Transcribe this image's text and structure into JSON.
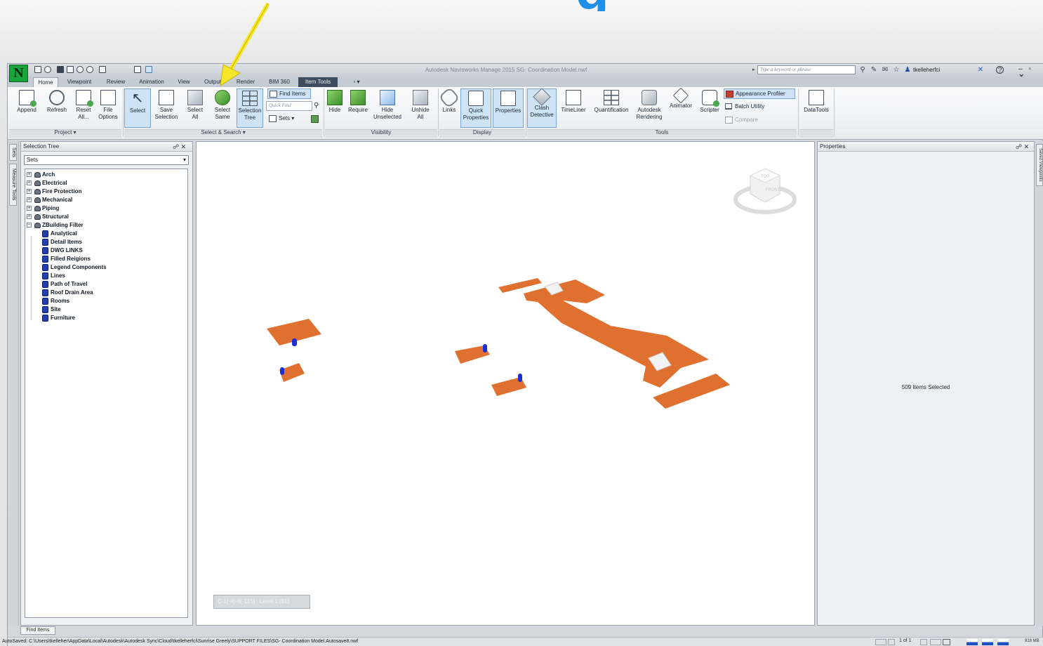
{
  "window": {
    "title": "Autodesk Navisworks Manage 2015   SG- Coordination Model.nwf",
    "logo_letter": "N",
    "help_search_placeholder": "Type a keyword or phrase",
    "user": "tkelleherfci",
    "controls": "– ▫ ✕"
  },
  "slide": {
    "title_fragment": "g"
  },
  "tabs": [
    {
      "label": "Home",
      "active": true
    },
    {
      "label": "Viewpoint"
    },
    {
      "label": "Review"
    },
    {
      "label": "Animation"
    },
    {
      "label": "View"
    },
    {
      "label": "Output"
    },
    {
      "label": "Render"
    },
    {
      "label": "BIM 360"
    },
    {
      "label": "Item Tools",
      "contextual": true
    },
    {
      "label": "▫ ▾"
    }
  ],
  "ribbon": {
    "project": {
      "title": "Project ▾",
      "buttons": [
        {
          "label": "Append",
          "icon": "append-icon"
        },
        {
          "label": "Refresh",
          "icon": "refresh-icon"
        },
        {
          "label": "Reset\nAll...",
          "icon": "reset-all-icon"
        },
        {
          "label": "File\nOptions",
          "icon": "file-options-icon"
        }
      ]
    },
    "select_search": {
      "title": "Select & Search ▾",
      "buttons": [
        {
          "label": "Select",
          "icon": "select-cursor-icon"
        },
        {
          "label": "Save\nSelection",
          "icon": "save-selection-icon"
        },
        {
          "label": "Select\nAll",
          "icon": "select-all-icon"
        },
        {
          "label": "Select\nSame",
          "icon": "select-same-icon"
        },
        {
          "label": "Selection\nTree",
          "icon": "selection-tree-icon"
        }
      ],
      "find_items": "Find Items",
      "quick_find_placeholder": "Quick Find",
      "sets": "Sets"
    },
    "visibility": {
      "title": "Visibility",
      "buttons": [
        {
          "label": "Hide",
          "icon": "hide-icon"
        },
        {
          "label": "Require",
          "icon": "require-icon"
        },
        {
          "label": "Hide\nUnselected",
          "icon": "hide-unselected-icon"
        },
        {
          "label": "Unhide\nAll",
          "icon": "unhide-all-icon"
        }
      ]
    },
    "display": {
      "title": "Display",
      "buttons": [
        {
          "label": "Links",
          "icon": "links-icon"
        },
        {
          "label": "Quick\nProperties",
          "icon": "quick-properties-icon"
        },
        {
          "label": "Properties",
          "icon": "properties-icon"
        }
      ]
    },
    "tools": {
      "title": "Tools",
      "buttons": [
        {
          "label": "Clash\nDetective",
          "icon": "clash-detective-icon"
        },
        {
          "label": "TimeLiner",
          "icon": "timeliner-icon"
        },
        {
          "label": "Quantification",
          "icon": "quantification-icon"
        },
        {
          "label": "Autodesk\nRendering",
          "icon": "rendering-icon"
        },
        {
          "label": "Animator",
          "icon": "animator-icon"
        },
        {
          "label": "Scripter",
          "icon": "scripter-icon"
        }
      ],
      "appearance_profiler": "Appearance Profiler",
      "batch_utility": "Batch Utility",
      "compare": "Compare",
      "datatools": "DataTools"
    }
  },
  "left_side_tabs": [
    "Sets",
    "Measure Tools"
  ],
  "selection_tree": {
    "title": "Selection Tree",
    "pane_controls": "☍ ✕",
    "dropdown_value": "Sets",
    "top_sets": [
      "Arch",
      "Electrical",
      "Fire Protection",
      "Mechanical",
      "Piping",
      "Structural",
      "ZBuilding Filter"
    ],
    "children": [
      "Analytical",
      "Detail Items",
      "DWG LINKS",
      "Filled Reigions",
      "Legend Components",
      "Lines",
      "Path of Travel",
      "Roof Drain Area",
      "Rooms",
      "Site",
      "Furniture"
    ]
  },
  "viewport": {
    "status_text": "C-1(-4)-6(-115) : Level 1 (91)",
    "viewcube": {
      "top": "TOP",
      "front": "FRONT"
    }
  },
  "properties": {
    "title": "Properties",
    "pane_controls": "☍ ✕",
    "selection_summary": "509 Items Selected",
    "side_tab": "Saved Viewpoints"
  },
  "bottom": {
    "find_items_tab": "Find Items",
    "autosave_path": "AutoSaved: C:\\Users\\tkelleher\\AppData\\Local\\Autodesk\\Autodesk Sync\\Cloud\\tkelleherfci\\Sunrise Greely\\SUPPORT FILES\\SG- Coordination Model.Autosave8.nwf",
    "page_indicator": "1 of 1",
    "memory": "918 MB"
  },
  "colors": {
    "accent_blue": "#1f8ee8",
    "slab_orange": "#e0702f",
    "annotation_yellow": "#f5e62a",
    "ribbon_pressed": "#cfe3f7"
  }
}
